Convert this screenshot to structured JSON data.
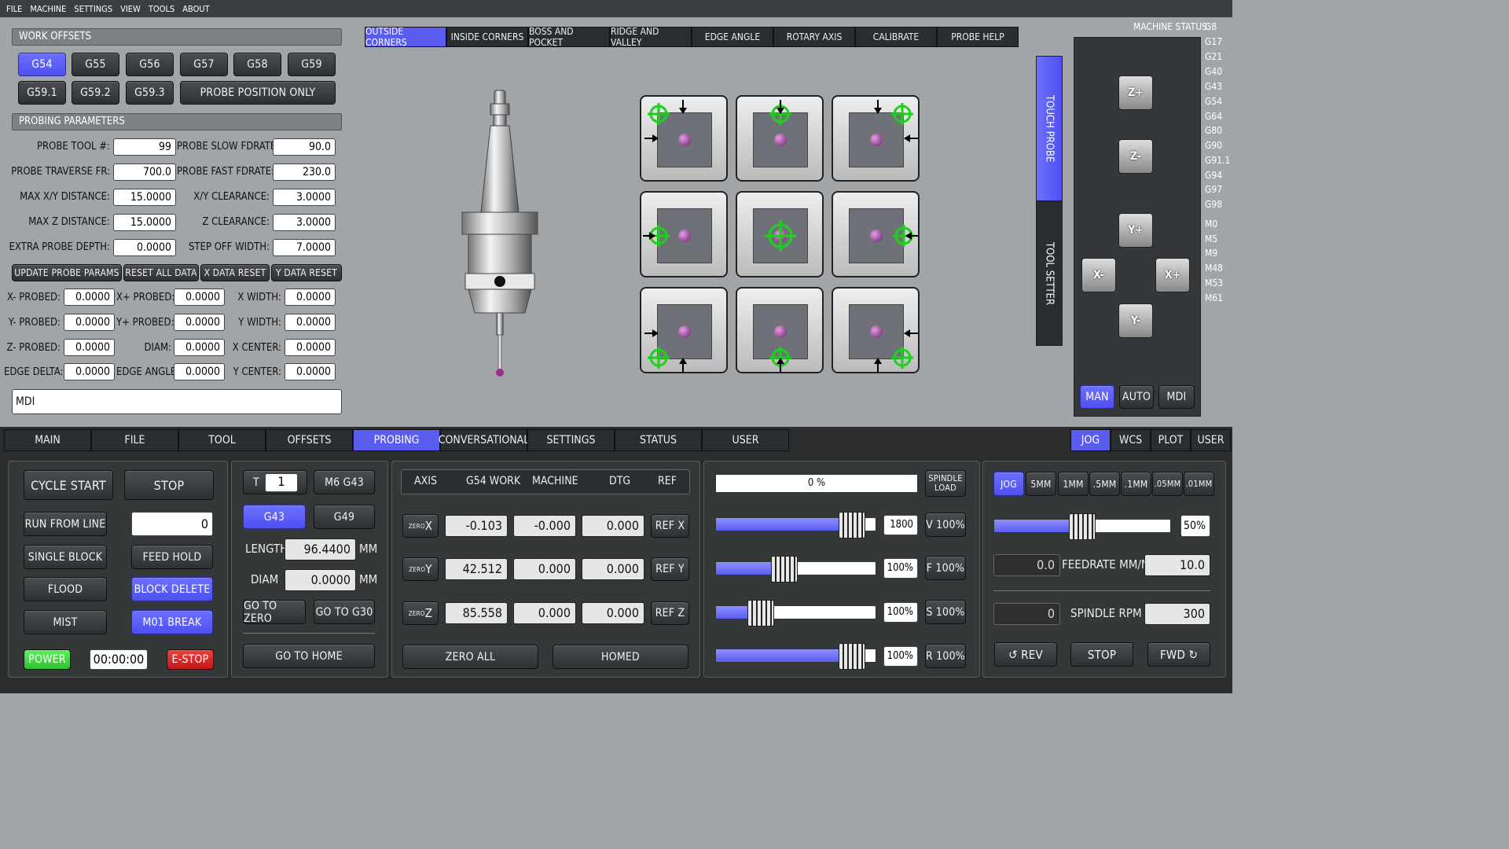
{
  "menu": [
    "FILE",
    "MACHINE",
    "SETTINGS",
    "VIEW",
    "TOOLS",
    "ABOUT"
  ],
  "work_offsets": {
    "title": "WORK OFFSETS",
    "row1": [
      "G54",
      "G55",
      "G56",
      "G57",
      "G58",
      "G59"
    ],
    "row2": [
      "G59.1",
      "G59.2",
      "G59.3"
    ],
    "probe_only": "PROBE POSITION ONLY"
  },
  "probing_params": {
    "title": "PROBING PARAMETERS",
    "left": [
      {
        "label": "PROBE TOOL #:",
        "value": "99"
      },
      {
        "label": "PROBE TRAVERSE FR:",
        "value": "700.0"
      },
      {
        "label": "MAX X/Y DISTANCE:",
        "value": "15.0000"
      },
      {
        "label": "MAX Z DISTANCE:",
        "value": "15.0000"
      },
      {
        "label": "EXTRA PROBE DEPTH:",
        "value": "0.0000"
      }
    ],
    "right": [
      {
        "label": "PROBE SLOW FDRATE:",
        "value": "90.0"
      },
      {
        "label": "PROBE FAST FDRATE:",
        "value": "230.0"
      },
      {
        "label": "X/Y CLEARANCE:",
        "value": "3.0000"
      },
      {
        "label": "Z CLEARANCE:",
        "value": "3.0000"
      },
      {
        "label": "STEP OFF WIDTH:",
        "value": "7.0000"
      }
    ]
  },
  "param_buttons": [
    "UPDATE PROBE PARAMS",
    "RESET ALL DATA",
    "X DATA RESET",
    "Y DATA RESET"
  ],
  "results": {
    "col1": [
      {
        "label": "X- PROBED:",
        "value": "0.0000"
      },
      {
        "label": "Y- PROBED:",
        "value": "0.0000"
      },
      {
        "label": "Z- PROBED:",
        "value": "0.0000"
      },
      {
        "label": "EDGE DELTA:",
        "value": "0.0000"
      }
    ],
    "col2": [
      {
        "label": "X+ PROBED:",
        "value": "0.0000"
      },
      {
        "label": "Y+ PROBED:",
        "value": "0.0000"
      },
      {
        "label": "DIAM:",
        "value": "0.0000"
      },
      {
        "label": "EDGE ANGLE:",
        "value": "0.0000"
      }
    ],
    "col3": [
      {
        "label": "X WIDTH:",
        "value": "0.0000"
      },
      {
        "label": "Y WIDTH:",
        "value": "0.0000"
      },
      {
        "label": "X CENTER:",
        "value": "0.0000"
      },
      {
        "label": "Y CENTER:",
        "value": "0.0000"
      }
    ]
  },
  "mdi": "MDI",
  "probe_tabs": [
    "OUTSIDE CORNERS",
    "INSIDE CORNERS",
    "BOSS AND POCKET",
    "RIDGE AND VALLEY",
    "EDGE ANGLE",
    "ROTARY AXIS",
    "CALIBRATE",
    "PROBE HELP"
  ],
  "side_tabs": [
    "TOUCH PROBE",
    "TOOL SETTER"
  ],
  "machine_status": {
    "label": "MACHINE STATUS:",
    "codes": [
      "G8",
      "G17",
      "G21",
      "G40",
      "G43",
      "G54",
      "G64",
      "G80",
      "G90",
      "G91.1",
      "G94",
      "G97",
      "G98",
      "M0",
      "M5",
      "M9",
      "M48",
      "M53",
      "M61"
    ]
  },
  "jog_buttons": {
    "zp": "Z+",
    "zm": "Z-",
    "yp": "Y+",
    "ym": "Y-",
    "xm": "X-",
    "xp": "X+"
  },
  "mode_buttons": [
    "MAN",
    "AUTO",
    "MDI"
  ],
  "main_tabs": [
    "MAIN",
    "FILE",
    "TOOL",
    "OFFSETS",
    "PROBING",
    "CONVERSATIONAL",
    "SETTINGS",
    "STATUS",
    "USER"
  ],
  "right_tabs": [
    "JOG",
    "WCS",
    "PLOT",
    "USER"
  ],
  "cycle": {
    "start": "CYCLE START",
    "stop": "STOP",
    "run_from_line": "RUN FROM LINE",
    "line_value": "0",
    "single_block": "SINGLE BLOCK",
    "feed_hold": "FEED HOLD",
    "flood": "FLOOD",
    "block_delete": "BLOCK DELETE",
    "mist": "MIST",
    "m01": "M01 BREAK",
    "power": "POWER",
    "timer": "00:00:00",
    "estop": "E-STOP"
  },
  "tool": {
    "t_label": "T",
    "t_value": "1",
    "m6": "M6 G43",
    "g43": "G43",
    "g49": "G49",
    "length_label": "LENGTH",
    "length_value": "96.4400",
    "diam_label": "DIAM",
    "diam_value": "0.0000",
    "unit": "MM",
    "go_zero": "GO TO ZERO",
    "go_g30": "GO TO G30",
    "go_home": "GO TO HOME"
  },
  "dro": {
    "headers": [
      "AXIS",
      "G54 WORK",
      "MACHINE",
      "DTG",
      "REF"
    ],
    "rows": [
      {
        "zero": "ZERO",
        "axis": "X",
        "work": "-0.103",
        "machine": "-0.000",
        "dtg": "0.000",
        "ref": "REF X"
      },
      {
        "zero": "ZERO",
        "axis": "Y",
        "work": "42.512",
        "machine": "0.000",
        "dtg": "0.000",
        "ref": "REF Y"
      },
      {
        "zero": "ZERO",
        "axis": "Z",
        "work": "85.558",
        "machine": "0.000",
        "dtg": "0.000",
        "ref": "REF Z"
      }
    ],
    "zero_all": "ZERO ALL",
    "homed": "HOMED"
  },
  "overrides": {
    "spindle_load": "0 %",
    "spindle_load_label1": "SPINDLE",
    "spindle_load_label2": "LOAD",
    "rows": [
      {
        "value": "1800",
        "btn": "V 100%",
        "fill": 0.85
      },
      {
        "value": "100%",
        "btn": "F 100%",
        "fill": 0.43
      },
      {
        "value": "100%",
        "btn": "S 100%",
        "fill": 0.28
      },
      {
        "value": "100%",
        "btn": "R 100%",
        "fill": 0.85
      }
    ]
  },
  "jog_panel": {
    "increments": [
      "JOG",
      "5MM",
      "1MM",
      ".5MM",
      ".1MM",
      ".05MM",
      ".01MM"
    ],
    "jog_rate": "50%",
    "jog_fill": 0.5,
    "feed_actual": "0.0",
    "feed_label": "FEEDRATE MM/M",
    "feed_value": "10.0",
    "rpm_actual": "0",
    "rpm_label": "SPINDLE RPM",
    "rpm_value": "300",
    "rev": "REV",
    "stop": "STOP",
    "fwd": "FWD"
  },
  "colors": {
    "accent": "#5a5cf0",
    "power": "#3ad93a",
    "estop": "#e02020",
    "probe_target": "#1ed01e"
  }
}
